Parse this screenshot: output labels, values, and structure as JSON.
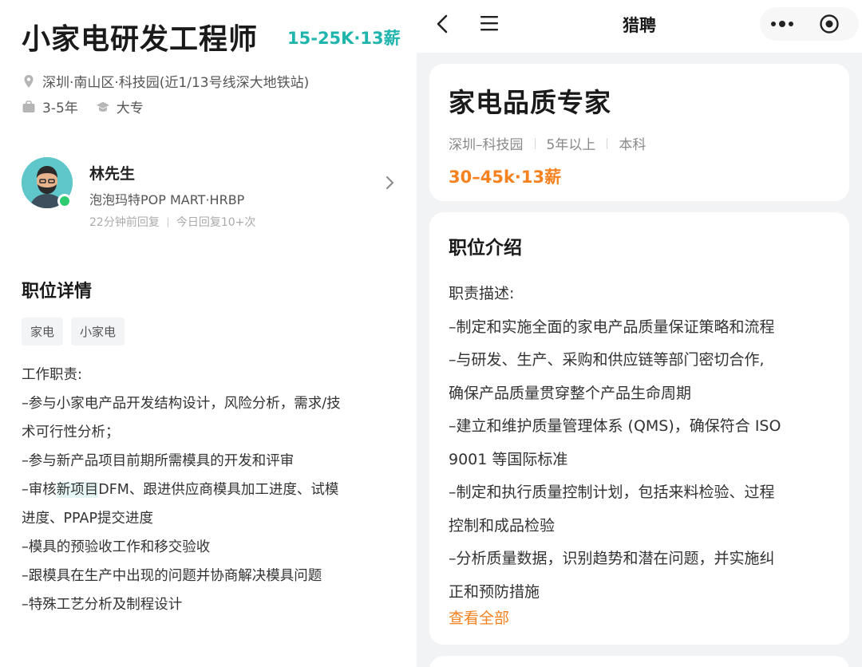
{
  "left": {
    "job_title": "小家电研发工程师",
    "salary": "15-25K·13薪",
    "location": "深圳·南山区·科技园(近1/13号线深大地铁站)",
    "experience": "3-5年",
    "education": "大专",
    "recruiter": {
      "name": "林先生",
      "company": "泡泡玛特POP MART·HRBP",
      "last_reply": "22分钟前回复",
      "reply_count": "今日回复10+次"
    },
    "section_title": "职位详情",
    "tags": [
      "家电",
      "小家电"
    ],
    "description_lines": [
      "工作职责:",
      "–参与小家电产品开发结构设计，风险分析，需求/技",
      "术可行性分析；",
      "–参与新产品项目前期所需模具的开发和评审",
      "–审核新项目DFM、跟进供应商模具加工进度、试模",
      "进度、PPAP提交进度",
      "–模具的预验收工作和移交验收",
      "–跟模具在生产中出现的问题并协商解决模具问题",
      "–特殊工艺分析及制程设计"
    ]
  },
  "right": {
    "app_title": "猎聘",
    "job_title": "家电品质专家",
    "location": "深圳–科技园",
    "experience": "5年以上",
    "education": "本科",
    "salary": "30–45k·13薪",
    "section_title": "职位介绍",
    "description_lines": [
      "职责描述:",
      "–制定和实施全面的家电产品质量保证策略和流程",
      "–与研发、生产、采购和供应链等部门密切合作,",
      "确保产品质量贯穿整个产品生命周期",
      "–建立和维护质量管理体系 (QMS)，确保符合 ISO",
      "9001 等国际标准",
      "–制定和执行质量控制计划，包括来料检验、过程",
      "控制和成品检验",
      "–分析质量数据，识别趋势和潜在问题，并实施纠",
      "正和预防措施"
    ],
    "view_all": "查看全部"
  },
  "colors": {
    "salary_left": "#1fb5ad",
    "salary_right": "#f5811f",
    "link": "#f5811f",
    "online": "#2ecc71"
  },
  "icons": [
    "location-pin-icon",
    "briefcase-icon",
    "graduation-cap-icon",
    "chevron-right-icon",
    "back-arrow-icon",
    "menu-icon",
    "more-dots-icon",
    "target-icon"
  ]
}
